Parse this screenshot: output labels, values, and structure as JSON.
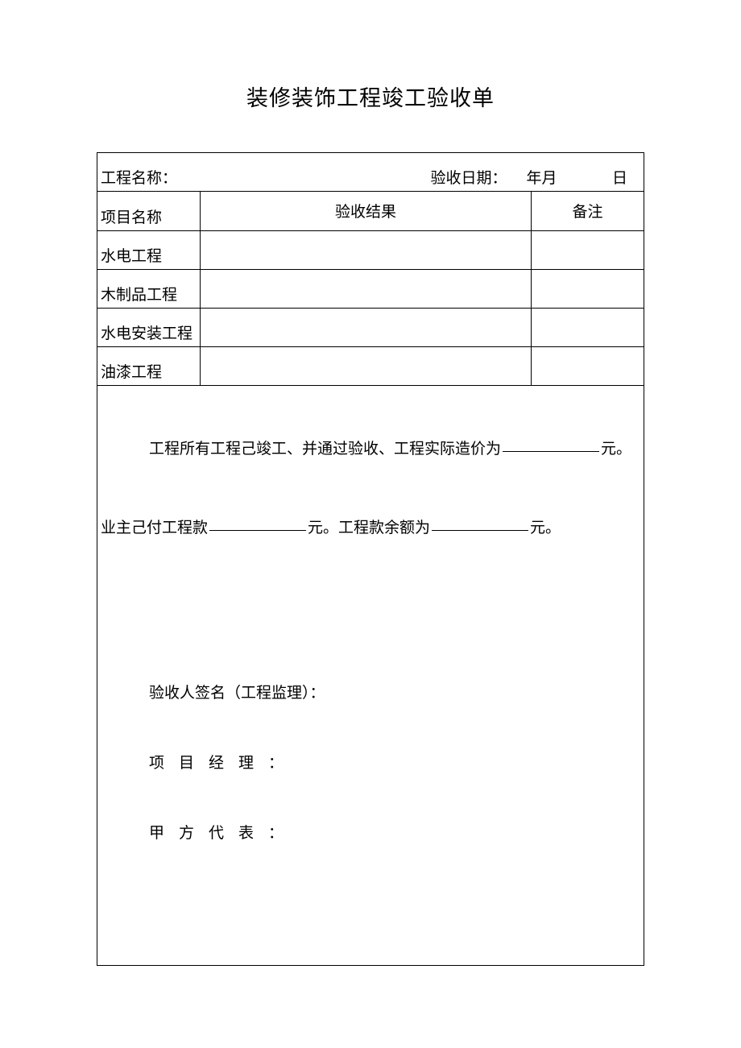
{
  "title": "装修装饰工程竣工验收单",
  "row1": {
    "project_name_label": "工程名称：",
    "accept_date_label": "验收日期：",
    "year_month": "年月",
    "day": "日"
  },
  "header": {
    "item_name": "项目名称",
    "result": "验收结果",
    "remark": "备注"
  },
  "items": [
    {
      "name": "水电工程"
    },
    {
      "name": "木制品工程"
    },
    {
      "name": "水电安装工程"
    },
    {
      "name": "油漆工程"
    }
  ],
  "statement": {
    "part1_prefix": "工程所有工程己竣工、并通过验收、工程实际造价为",
    "part1_suffix": "元。",
    "part2_prefix": "业主己付工程款",
    "part2_mid": "元。工程款余额为",
    "part2_suffix": "元。"
  },
  "signatures": {
    "inspector": "验收人签名（工程监理）：",
    "manager_label": "项目经理",
    "owner_label": "甲方代表",
    "colon": "："
  }
}
